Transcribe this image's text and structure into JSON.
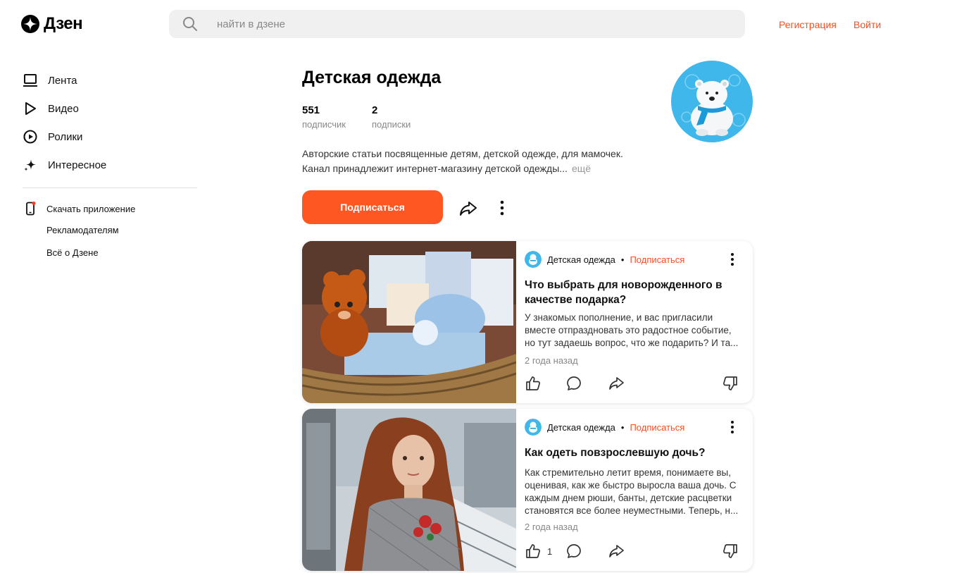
{
  "header": {
    "logo_text": "Дзен",
    "search_placeholder": "найти в дзене",
    "register_label": "Регистрация",
    "login_label": "Войти",
    "accent_color": "#ff4d1f"
  },
  "sidebar": {
    "nav": [
      {
        "label": "Лента",
        "icon": "feed-icon"
      },
      {
        "label": "Видео",
        "icon": "play-icon"
      },
      {
        "label": "Ролики",
        "icon": "shorts-icon"
      },
      {
        "label": "Интересное",
        "icon": "sparkle-icon"
      }
    ],
    "download_label": "Скачать приложение",
    "links": [
      "Рекламодателям",
      "Всё о Дзене"
    ]
  },
  "channel": {
    "title": "Детская одежда",
    "subscribers_count": "551",
    "subscribers_label": "подписчик",
    "subscriptions_count": "2",
    "subscriptions_label": "подписки",
    "description_line1": "Авторские статьи посвященные детям, детской одежде, для мамочек.",
    "description_line2": "Канал принадлежит интернет-магазину детской одежды...",
    "more_label": "ещё",
    "subscribe_label": "Подписаться",
    "subscribe_color": "#ff5722"
  },
  "cards": [
    {
      "source": "Детская одежда",
      "dot": "•",
      "subscribe": "Подписаться",
      "title": "Что выбрать для новорожденного в качестве подарка?",
      "text": "У знакомых пополнение, и вас пригласили вместе отпраздновать это радостное событие, но тут задаешь вопрос, что же подарить? И та...",
      "ago": "2 года назад",
      "likes": ""
    },
    {
      "source": "Детская одежда",
      "dot": "•",
      "subscribe": "Подписаться",
      "title": "Как одеть повзрослевшую дочь?",
      "text": "Как стремительно летит время, понимаете вы, оценивая, как же быстро выросла ваша дочь. С каждым днем рюши, банты, детские расцветки становятся все более неуместными. Теперь, н...",
      "ago": "2 года назад",
      "likes": "1"
    }
  ]
}
